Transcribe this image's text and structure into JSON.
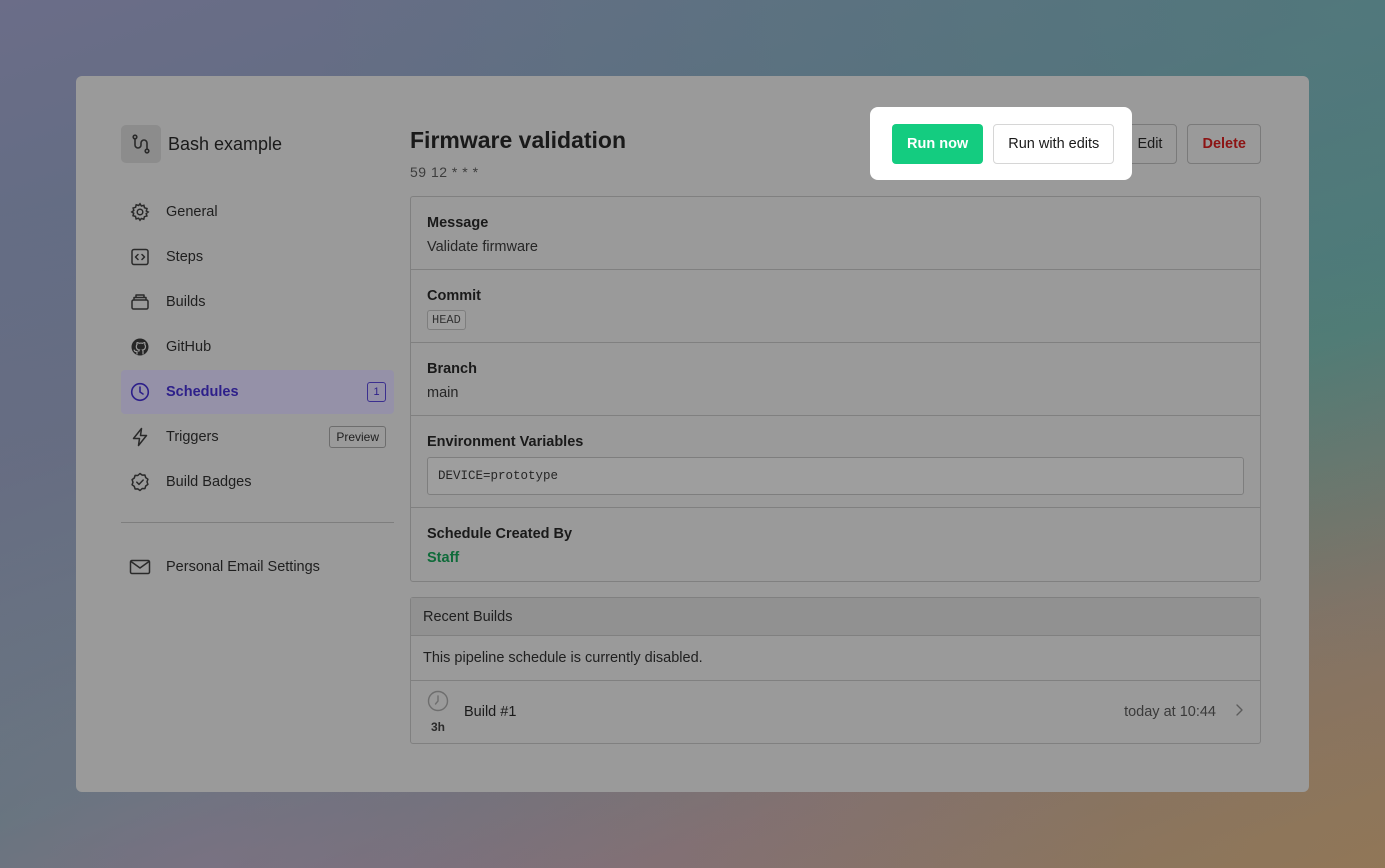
{
  "pipeline": {
    "name": "Bash example"
  },
  "sidebar": {
    "items": [
      {
        "label": "General",
        "icon": "gear-icon"
      },
      {
        "label": "Steps",
        "icon": "code-icon"
      },
      {
        "label": "Builds",
        "icon": "stack-icon"
      },
      {
        "label": "GitHub",
        "icon": "github-icon"
      },
      {
        "label": "Schedules",
        "icon": "clock-icon",
        "badge": "1",
        "active": true
      },
      {
        "label": "Triggers",
        "icon": "bolt-icon",
        "badge": "Preview"
      },
      {
        "label": "Build Badges",
        "icon": "check-badge-icon"
      }
    ],
    "footer_item": {
      "label": "Personal Email Settings",
      "icon": "mail-icon"
    }
  },
  "schedule": {
    "title": "Firmware validation",
    "cron": "59 12 * * *",
    "actions": {
      "run_now": "Run now",
      "run_with_edits": "Run with edits",
      "edit": "Edit",
      "delete": "Delete"
    },
    "fields": {
      "message": {
        "label": "Message",
        "value": "Validate firmware"
      },
      "commit": {
        "label": "Commit",
        "value": "HEAD"
      },
      "branch": {
        "label": "Branch",
        "value": "main"
      },
      "env": {
        "label": "Environment Variables",
        "value": "DEVICE=prototype"
      },
      "created_by": {
        "label": "Schedule Created By",
        "value": "Staff"
      }
    }
  },
  "recent_builds": {
    "title": "Recent Builds",
    "note": "This pipeline schedule is currently disabled.",
    "builds": [
      {
        "name": "Build #1",
        "ago": "3h",
        "date": "today at 10:44"
      }
    ]
  },
  "colors": {
    "accent": "#14cc80",
    "active_nav": "#2d1f8a",
    "danger": "#8c1414"
  }
}
